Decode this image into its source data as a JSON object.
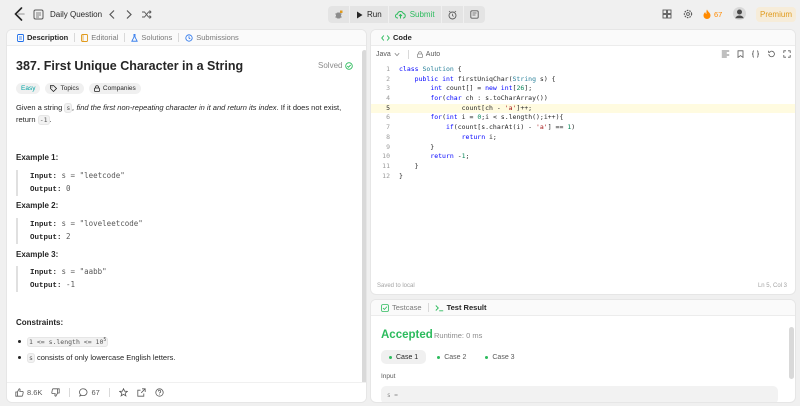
{
  "topbar": {
    "problem_list_label": "Daily Question",
    "run_label": "Run",
    "submit_label": "Submit",
    "streak_count": "67",
    "premium_label": "Premium"
  },
  "left_panel": {
    "tabs": [
      {
        "label": "Description"
      },
      {
        "label": "Editorial"
      },
      {
        "label": "Solutions"
      },
      {
        "label": "Submissions"
      }
    ],
    "title": "387. First Unique Character in a String",
    "solved_label": "Solved",
    "badges": {
      "difficulty": "Easy",
      "topics": "Topics",
      "companies": "Companies"
    },
    "description": {
      "pre": "Given a string ",
      "var_s": "s",
      "italic": ", find the first non-repeating character in it and return its index",
      "mid": ". If it does not exist, return ",
      "ret": "-1",
      "end": "."
    },
    "examples": [
      {
        "title": "Example 1:",
        "input_label": "Input:",
        "input_value": "s = \"leetcode\"",
        "output_label": "Output:",
        "output_value": "0"
      },
      {
        "title": "Example 2:",
        "input_label": "Input:",
        "input_value": "s = \"loveleetcode\"",
        "output_label": "Output:",
        "output_value": "2"
      },
      {
        "title": "Example 3:",
        "input_label": "Input:",
        "input_value": "s = \"aabb\"",
        "output_label": "Output:",
        "output_value": "-1"
      }
    ],
    "constraints_title": "Constraints:",
    "constraints": [
      {
        "code": "1 <= s.length <= 10",
        "sup": "5",
        "text": ""
      },
      {
        "code": "s",
        "sup": "",
        "text": " consists of only lowercase English letters."
      }
    ],
    "footer": {
      "likes": "8.6K",
      "comments": "67"
    }
  },
  "code_panel": {
    "tab_label": "Code",
    "language": "Java",
    "mode": "Auto",
    "lines": [
      "class Solution {",
      "    public int firstUniqChar(String s) {",
      "        int count[] = new int[26];",
      "        for(char ch : s.toCharArray())",
      "                count[ch - 'a']++;",
      "        for(int i = 0;i < s.length();i++){",
      "            if(count[s.charAt(i) - 'a'] == 1)",
      "                return i;",
      "        }",
      "        return -1;",
      "    }",
      "}"
    ],
    "status": "Saved to local",
    "cursor": "Ln 5, Col 3"
  },
  "result_panel": {
    "tabs": [
      {
        "label": "Testcase"
      },
      {
        "label": "Test Result"
      }
    ],
    "verdict": "Accepted",
    "runtime": "Runtime: 0 ms",
    "cases": [
      {
        "label": "Case 1"
      },
      {
        "label": "Case 2"
      },
      {
        "label": "Case 3"
      }
    ],
    "input_label": "Input",
    "input_value": "s ="
  },
  "colors": {
    "accent_green": "#2cbb5d",
    "easy": "#00a3a3",
    "premium": "#e09a1c",
    "streak": "#ff8a00"
  }
}
